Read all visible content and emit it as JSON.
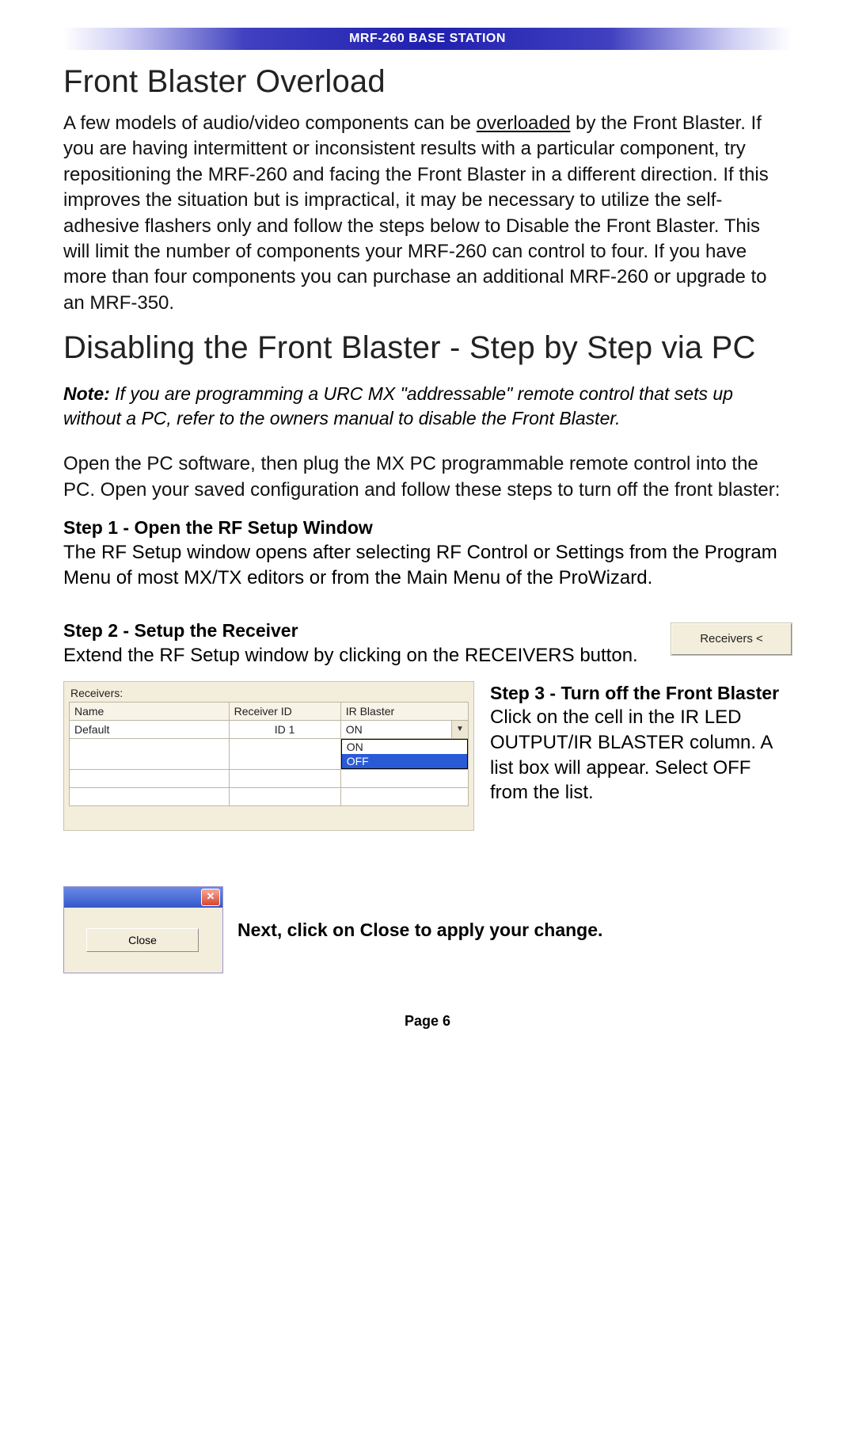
{
  "header": {
    "title": "MRF-260 BASE STATION"
  },
  "section1": {
    "heading": "Front Blaster Overload",
    "para_pre": "A few models of audio/video components can be ",
    "para_ul": "overloaded",
    "para_post": " by the Front Blaster. If you are having intermittent or inconsistent results with a particular component, try repositioning the MRF-260 and facing the Front Blaster in a different direction. If this improves the situation but is impractical, it may be necessary to utilize the self-adhesive flashers only and follow the steps below to Disable the Front Blaster.  This will limit the number of components your MRF-260 can control to four. If you have more than four components you can purchase an additional MRF-260 or upgrade to an MRF-350."
  },
  "section2": {
    "heading": "Disabling the Front Blaster - Step by Step via PC",
    "note_label": "Note:",
    "note_body": "  If you are programming a URC MX \"addressable\" remote control that sets up without a PC, refer to the owners manual to disable the Front Blaster.",
    "intro": "Open the PC software, then plug the MX PC programmable remote control into the PC. Open your saved configuration and follow these steps to turn off the front blaster:"
  },
  "step1": {
    "title": "Step 1 - Open the RF Setup Window",
    "body": "The RF Setup window opens after selecting RF Control or Settings from the Program Menu of most MX/TX editors or from the Main Menu of the ProWizard."
  },
  "step2": {
    "title": "Step 2 - Setup the Receiver",
    "body": "Extend the RF Setup window by clicking on the RECEIVERS button.",
    "button_label": "Receivers <"
  },
  "step3": {
    "title": "Step 3 - Turn off the Front Blaster",
    "body": "Click on the cell in the IR LED OUTPUT/IR BLASTER column. A list box will appear. Select OFF from the list.",
    "grid": {
      "label": "Receivers:",
      "columns": [
        "Name",
        "Receiver ID",
        "IR Blaster"
      ],
      "row": {
        "name": "Default",
        "id": "ID 1",
        "blaster": "ON"
      },
      "options": [
        "ON",
        "OFF"
      ],
      "selected_index": 1
    }
  },
  "closing": {
    "caption": "Next, click on Close to apply your change.",
    "close_label": "Close",
    "x_label": "✕"
  },
  "footer": {
    "page": "Page 6"
  }
}
